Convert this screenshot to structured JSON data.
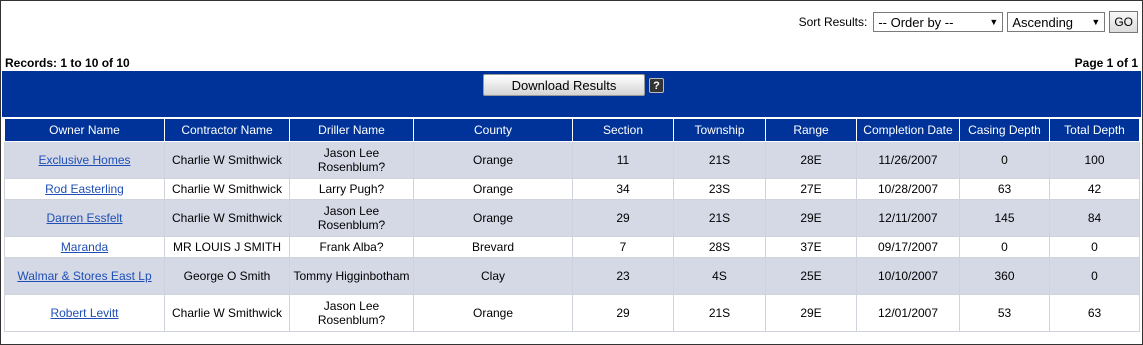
{
  "sort": {
    "label": "Sort Results:",
    "order_by": "-- Order by --",
    "direction": "Ascending",
    "go_label": "GO"
  },
  "records_text": "Records: 1 to 10 of 10",
  "page_text": "Page 1 of 1",
  "download_label": "Download Results",
  "help_glyph": "?",
  "colors": {
    "header_blue": "#003399",
    "row_shade": "#d5d9e6",
    "link": "#1f4fb5"
  },
  "columns": [
    "Owner Name",
    "Contractor Name",
    "Driller Name",
    "County",
    "Section",
    "Township",
    "Range",
    "Completion Date",
    "Casing Depth",
    "Total Depth"
  ],
  "rows": [
    {
      "owner": "Exclusive Homes",
      "contractor": "Charlie W Smithwick",
      "driller": "Jason Lee Rosenblum?",
      "county": "Orange",
      "section": "11",
      "township": "21S",
      "range": "28E",
      "completion": "11/26/2007",
      "casing": "0",
      "total": "100"
    },
    {
      "owner": "Rod Easterling",
      "contractor": "Charlie W Smithwick",
      "driller": "Larry Pugh?",
      "county": "Orange",
      "section": "34",
      "township": "23S",
      "range": "27E",
      "completion": "10/28/2007",
      "casing": "63",
      "total": "42"
    },
    {
      "owner": "Darren Essfelt",
      "contractor": "Charlie W Smithwick",
      "driller": "Jason Lee Rosenblum?",
      "county": "Orange",
      "section": "29",
      "township": "21S",
      "range": "29E",
      "completion": "12/11/2007",
      "casing": "145",
      "total": "84"
    },
    {
      "owner": "Maranda",
      "contractor": "MR LOUIS J SMITH",
      "driller": "Frank Alba?",
      "county": "Brevard",
      "section": "7",
      "township": "28S",
      "range": "37E",
      "completion": "09/17/2007",
      "casing": "0",
      "total": "0"
    },
    {
      "owner": "Walmar & Stores East Lp",
      "contractor": "George O Smith",
      "driller": "Tommy Higginbotham",
      "county": "Clay",
      "section": "23",
      "township": "4S",
      "range": "25E",
      "completion": "10/10/2007",
      "casing": "360",
      "total": "0"
    },
    {
      "owner": "Robert Levitt",
      "contractor": "Charlie W Smithwick",
      "driller": "Jason Lee Rosenblum?",
      "county": "Orange",
      "section": "29",
      "township": "21S",
      "range": "29E",
      "completion": "12/01/2007",
      "casing": "53",
      "total": "63"
    }
  ]
}
